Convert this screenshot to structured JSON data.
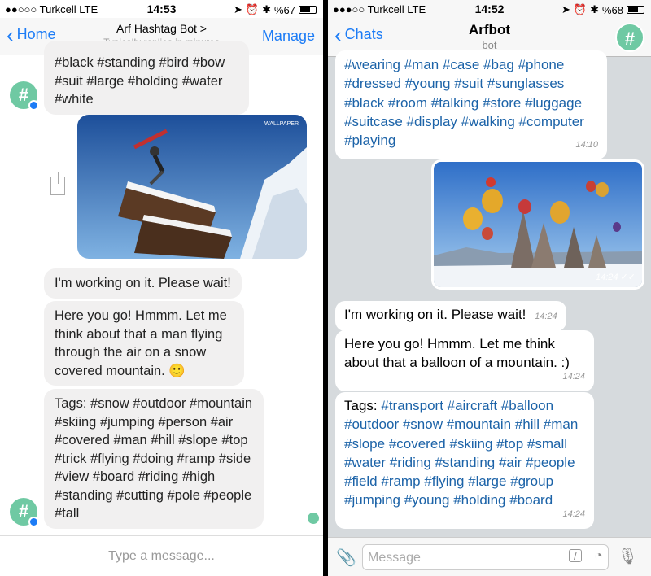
{
  "left": {
    "status": {
      "carrier": "●●○○○ Turkcell  LTE",
      "time": "14:53",
      "battery": "%67",
      "battery_level": 0.67
    },
    "nav": {
      "back": "Home",
      "title": "Arf Hashtag Bot >",
      "subtitle": "Typically replies in minutes",
      "manage": "Manage"
    },
    "top_tags": "#black #standing #bird #bow #suit #large #holding #water #white",
    "working": "I'm working on it. Please wait!",
    "reply": "Here you go! Hmmm. Let me think about that a man flying through the air on a snow covered mountain. 🙂",
    "tags": "Tags: #snow #outdoor #mountain #skiing #jumping #person #air #covered #man #hill #slope #top #trick #flying #doing #ramp #side #view #board #riding #high #standing #cutting #pole #people #tall",
    "compose_placeholder": "Type a message...",
    "image_badge": "WALLPAPER"
  },
  "right": {
    "status": {
      "carrier": "●●●○○ Turkcell  LTE",
      "time": "14:52",
      "battery": "%68",
      "battery_level": 0.68
    },
    "nav": {
      "back": "Chats",
      "title": "Arfbot",
      "subtitle": "bot"
    },
    "top_tags": "#wearing #man #case #bag #phone #dressed #young #suit #sunglasses #black #room #talking #store #luggage #suitcase #display #walking #computer #playing",
    "top_time": "14:10",
    "image_time": "14:24 ✓✓",
    "working": "I'm working on it. Please wait!",
    "working_time": "14:24",
    "reply": "Here you go! Hmmm. Let me think about that a balloon of a mountain. :)",
    "reply_time": "14:24",
    "tags_label": "Tags:",
    "tags": "#transport #aircraft #balloon #outdoor #snow #mountain #hill #man #slope #covered #skiing #top #small #water #riding #standing #air #people #field #ramp #flying #large #group #jumping #young #holding #board",
    "tags_time": "14:24",
    "compose_placeholder": "Message"
  },
  "colors": {
    "messenger_blue": "#1c7cf6",
    "telegram_link": "#1c63a8",
    "avatar_green": "#6fc9a3"
  }
}
